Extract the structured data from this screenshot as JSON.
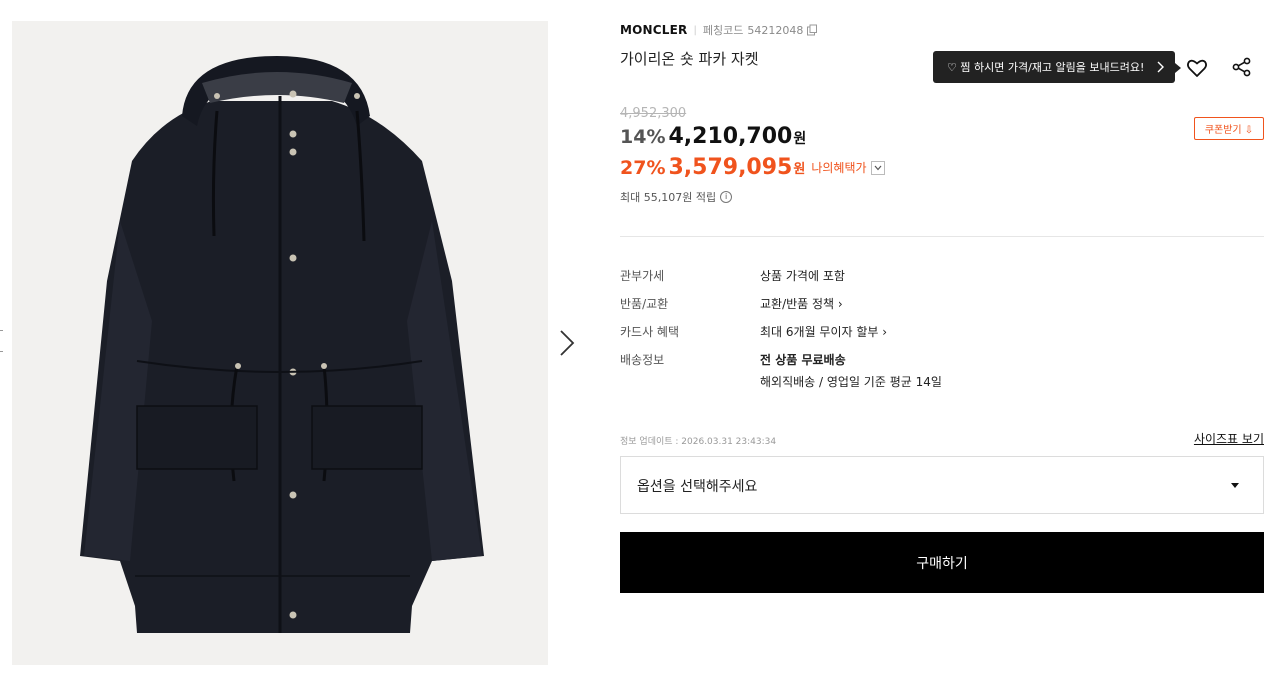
{
  "product": {
    "brand": "MONCLER",
    "code_label": "페칭코드",
    "code_value": "54212048",
    "name": "가이리온 숏 파카 자켓",
    "image_icon": "jacket-photo"
  },
  "tooltip": {
    "message": "♡ 찜 하시면 가격/재고 알림을 보내드려요!"
  },
  "price": {
    "original": "4,952,300",
    "discount_pct": "14%",
    "sale": "4,210,700",
    "won": "원",
    "benefit_pct": "27%",
    "benefit_price": "3,579,095",
    "benefit_won": "원",
    "my_benefit_label": "나의혜택가",
    "points_text": "최대 55,107원 적립",
    "accent_color": "#f0531d"
  },
  "coupon": {
    "label": "쿠폰받기 ⇩"
  },
  "details": {
    "customs_label": "관부가세",
    "customs_value": "상품 가격에 포함",
    "return_label": "반품/교환",
    "return_value": "교환/반품 정책 ›",
    "card_label": "카드사 혜택",
    "card_value": "최대 6개월 무이자 할부 ›",
    "shipping_label": "배송정보",
    "shipping_value": "전 상품 무료배송",
    "shipping_sub": "해외직배송 / 영업일 기준 평균 14일"
  },
  "meta": {
    "updated": "정보 업데이트 : 2026.03.31 23:43:34",
    "size_chart": "사이즈표 보기"
  },
  "option": {
    "placeholder": "옵션을 선택해주세요"
  },
  "buy": {
    "label": "구매하기"
  }
}
